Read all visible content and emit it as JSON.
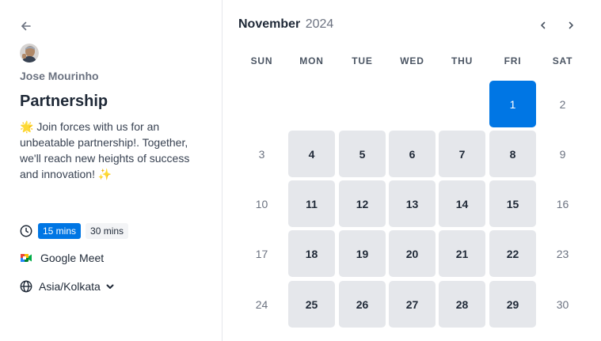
{
  "left_panel": {
    "host_name": "Jose Mourinho",
    "event_title": "Partnership",
    "description": "🌟 Join forces with us for an unbeatable partnership!. Together, we'll reach new heights of success and innovation! ✨",
    "durations": [
      "15 mins",
      "30 mins"
    ],
    "selected_duration": "15 mins",
    "location": "Google Meet",
    "timezone": "Asia/Kolkata"
  },
  "calendar": {
    "month": "November",
    "year": "2024",
    "weekdays": [
      "SUN",
      "MON",
      "TUE",
      "WED",
      "THU",
      "FRI",
      "SAT"
    ],
    "selected_day": "1",
    "weeks": [
      [
        null,
        null,
        null,
        null,
        null,
        {
          "d": "1",
          "s": "selected"
        },
        {
          "d": "2",
          "s": "off"
        }
      ],
      [
        {
          "d": "3",
          "s": "off"
        },
        {
          "d": "4",
          "s": "avail"
        },
        {
          "d": "5",
          "s": "avail"
        },
        {
          "d": "6",
          "s": "avail"
        },
        {
          "d": "7",
          "s": "avail"
        },
        {
          "d": "8",
          "s": "avail"
        },
        {
          "d": "9",
          "s": "off"
        }
      ],
      [
        {
          "d": "10",
          "s": "off"
        },
        {
          "d": "11",
          "s": "avail"
        },
        {
          "d": "12",
          "s": "avail"
        },
        {
          "d": "13",
          "s": "avail"
        },
        {
          "d": "14",
          "s": "avail"
        },
        {
          "d": "15",
          "s": "avail"
        },
        {
          "d": "16",
          "s": "off"
        }
      ],
      [
        {
          "d": "17",
          "s": "off"
        },
        {
          "d": "18",
          "s": "avail"
        },
        {
          "d": "19",
          "s": "avail"
        },
        {
          "d": "20",
          "s": "avail"
        },
        {
          "d": "21",
          "s": "avail"
        },
        {
          "d": "22",
          "s": "avail"
        },
        {
          "d": "23",
          "s": "off"
        }
      ],
      [
        {
          "d": "24",
          "s": "off"
        },
        {
          "d": "25",
          "s": "avail"
        },
        {
          "d": "26",
          "s": "avail"
        },
        {
          "d": "27",
          "s": "avail"
        },
        {
          "d": "28",
          "s": "avail"
        },
        {
          "d": "29",
          "s": "avail"
        },
        {
          "d": "30",
          "s": "off"
        }
      ]
    ]
  },
  "colors": {
    "accent": "#0076e4",
    "available_day_bg": "#e5e7eb",
    "text_primary": "#1f2937",
    "text_muted": "#6b7280"
  },
  "icons": {
    "back": "arrow-left-icon",
    "duration": "clock-icon",
    "location": "google-meet-icon",
    "timezone": "globe-icon",
    "timezone_toggle": "chevron-down-icon",
    "prev": "chevron-left-icon",
    "next": "chevron-right-icon"
  }
}
